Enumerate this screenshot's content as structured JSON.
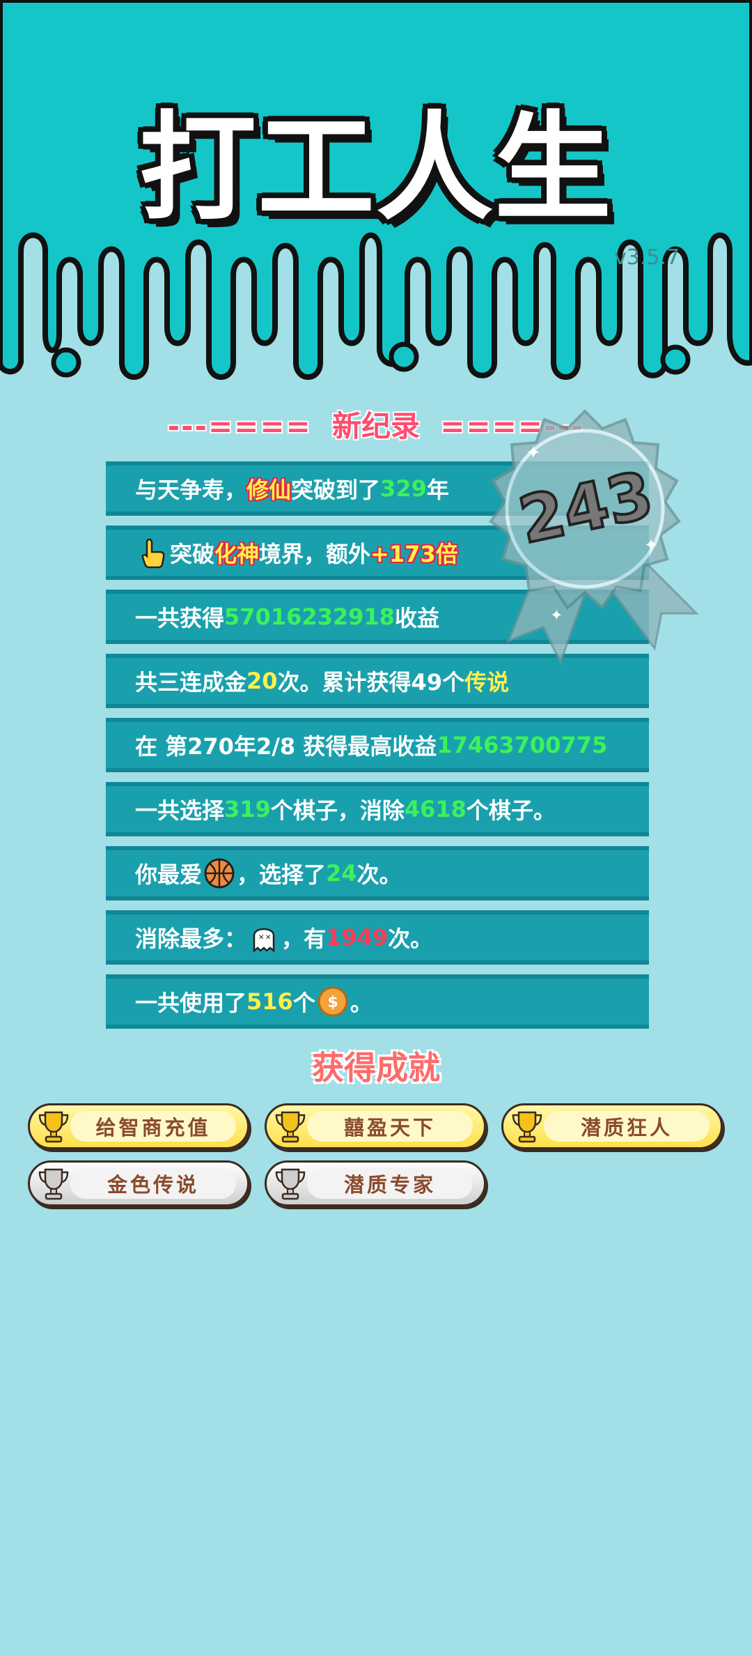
{
  "header": {
    "title": "打工人生",
    "version": "v3.5.7"
  },
  "record": {
    "title": "新纪录",
    "dashes_left": "---====",
    "dashes_right": "====---"
  },
  "medal": {
    "value": "243"
  },
  "rows": [
    {
      "parts": [
        {
          "t": "与天争寿，"
        },
        {
          "t": "修仙",
          "c": "tag-red"
        },
        {
          "t": "突破到了"
        },
        {
          "t": "329",
          "c": "g"
        },
        {
          "t": "年"
        }
      ]
    },
    {
      "parts": [
        {
          "t": "突破"
        },
        {
          "t": "化神",
          "c": "tag-red"
        },
        {
          "t": "境界，额外"
        },
        {
          "t": "+173倍",
          "c": "tag-red"
        }
      ],
      "icon": "pointing-hand-icon"
    },
    {
      "parts": [
        {
          "t": "一共获得"
        },
        {
          "t": "57016232918",
          "c": "g"
        },
        {
          "t": "收益"
        }
      ]
    },
    {
      "parts": [
        {
          "t": "共三连成金"
        },
        {
          "t": "20",
          "c": "y"
        },
        {
          "t": "次。累计获得49个"
        },
        {
          "t": "传说",
          "c": "y"
        }
      ]
    },
    {
      "parts": [
        {
          "t": "在 第270年2/8 获得最高收益"
        },
        {
          "t": "17463700775",
          "c": "g"
        }
      ]
    },
    {
      "parts": [
        {
          "t": "一共选择"
        },
        {
          "t": "319",
          "c": "g"
        },
        {
          "t": "个棋子，消除"
        },
        {
          "t": "4618",
          "c": "g"
        },
        {
          "t": "个棋子。"
        }
      ]
    },
    {
      "parts": [
        {
          "t": "你最爱"
        },
        {
          "icon": "basketball-icon"
        },
        {
          "t": "，选择了"
        },
        {
          "t": "24",
          "c": "g"
        },
        {
          "t": "次。"
        }
      ]
    },
    {
      "parts": [
        {
          "t": "消除最多："
        },
        {
          "icon": "ghost-icon"
        },
        {
          "t": "，有"
        },
        {
          "t": "1949",
          "c": "r"
        },
        {
          "t": "次。"
        }
      ]
    },
    {
      "parts": [
        {
          "t": "一共使用了"
        },
        {
          "t": "516",
          "c": "y"
        },
        {
          "t": "个"
        },
        {
          "icon": "coin-icon"
        },
        {
          "t": "。"
        }
      ]
    }
  ],
  "achievements": {
    "title": "获得成就",
    "items": [
      {
        "label": "给智商充值",
        "tier": "gold"
      },
      {
        "label": "囍盈天下",
        "tier": "gold"
      },
      {
        "label": "潜质狂人",
        "tier": "gold"
      },
      {
        "label": "金色传说",
        "tier": "silver"
      },
      {
        "label": "潜质专家",
        "tier": "silver"
      }
    ]
  },
  "colors": {
    "header_bg": "#15c6c9",
    "page_bg": "#a2dfe6",
    "row_bg": "#1aa0ad",
    "highlight_green": "#3cf25a",
    "highlight_yellow": "#fff04a",
    "highlight_red": "#ff3b57"
  }
}
